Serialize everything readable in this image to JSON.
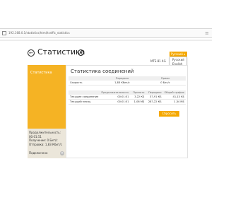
{
  "browser": {
    "url": "192.168.0.1/statistics/html/traffic_statistics",
    "menu_glyph": "≡"
  },
  "header": {
    "title": "Статистика"
  },
  "language": {
    "selected": "Русский ▾",
    "options": [
      "Русский",
      "English"
    ]
  },
  "device": {
    "label": "MTS 81 4G"
  },
  "sidebar": {
    "title": "Статистика",
    "stats": [
      "Продолжительность:",
      "00:01:51",
      "Получение: 0 Бит/с",
      "Отправка: 1,83 Кбит/с"
    ],
    "disconnect_label": "Подключено"
  },
  "main": {
    "section_title": "Статистика соединений",
    "speed_table": {
      "headers": [
        "",
        "Передача",
        "Прием"
      ],
      "rows": [
        [
          "Скорость",
          "1,83 Кбит/с",
          "0 Бит/с"
        ]
      ]
    },
    "usage_table": {
      "headers": [
        "",
        "Продолжительность",
        "Принято",
        "Передано",
        "Общий трафик"
      ],
      "rows": [
        [
          "Текущее соединение",
          "00:01:51",
          "3,22 КБ",
          "37,91 КБ",
          "41,13 КБ"
        ],
        [
          "Текущий месяц",
          "00:01:51",
          "1,06 МБ",
          "287,22 КБ",
          "1,34 МБ"
        ]
      ]
    },
    "reset_label": "Сбросить"
  },
  "colors": {
    "accent": "#f5a800",
    "sidebar": "#f5b324"
  }
}
